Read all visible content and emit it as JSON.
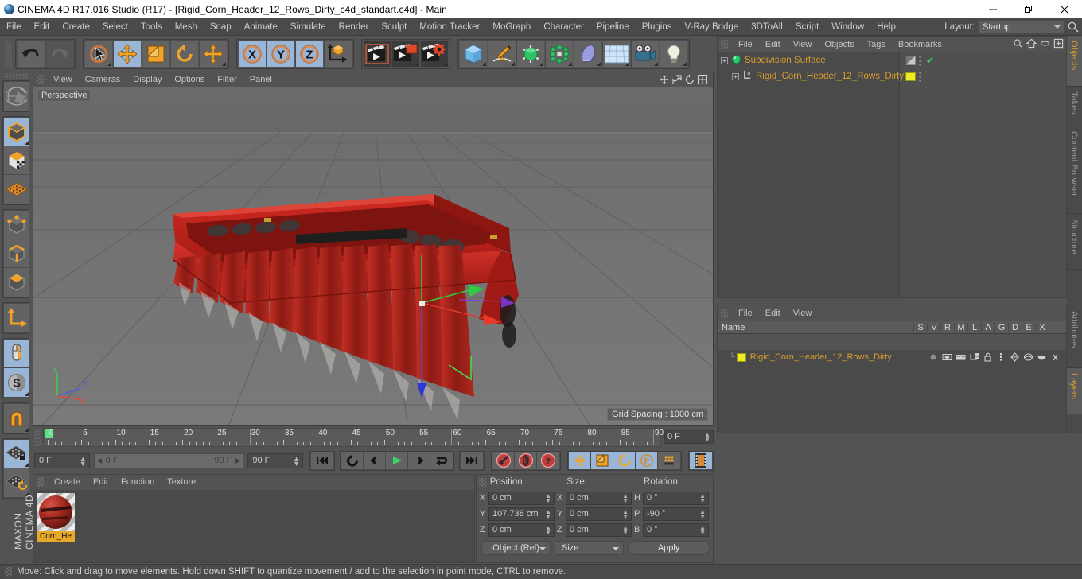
{
  "window": {
    "title": "CINEMA 4D R17.016 Studio (R17) - [Rigid_Corn_Header_12_Rows_Dirty_c4d_standart.c4d] - Main",
    "app_icon": "cinema4d-orb-icon",
    "minimize": "minimize-icon",
    "maximize": "restore-icon",
    "close": "close-icon"
  },
  "menubar": {
    "items": [
      "File",
      "Edit",
      "Create",
      "Select",
      "Tools",
      "Mesh",
      "Snap",
      "Animate",
      "Simulate",
      "Render",
      "Sculpt",
      "Motion Tracker",
      "MoGraph",
      "Character",
      "Pipeline",
      "Plugins",
      "V-Ray Bridge",
      "3DToAll",
      "Script",
      "Window",
      "Help"
    ],
    "layout_label": "Layout:",
    "layout_value": "Startup",
    "search_icon": "search-icon"
  },
  "toolbar": {
    "groups": [
      {
        "name": "history",
        "buttons": [
          {
            "icon": "undo-icon",
            "selected": false,
            "disabled": false
          },
          {
            "icon": "redo-icon",
            "selected": false,
            "disabled": true
          }
        ]
      },
      {
        "name": "selection-transform",
        "buttons": [
          {
            "icon": "live-selection-icon",
            "selected": false,
            "menu": true
          },
          {
            "icon": "move-icon",
            "selected": true
          },
          {
            "icon": "scale-icon",
            "selected": false
          },
          {
            "icon": "rotate-icon",
            "selected": false
          },
          {
            "icon": "move-dynamic-icon",
            "selected": false,
            "menu": true
          }
        ]
      },
      {
        "name": "axis-locks",
        "buttons": [
          {
            "icon": "x-axis-icon",
            "selected": true
          },
          {
            "icon": "y-axis-icon",
            "selected": true
          },
          {
            "icon": "z-axis-icon",
            "selected": true
          },
          {
            "icon": "world-object-axis-icon",
            "selected": false
          }
        ]
      },
      {
        "name": "render",
        "buttons": [
          {
            "icon": "render-view-icon",
            "selected": false
          },
          {
            "icon": "render-to-picture-viewer-icon",
            "selected": false,
            "menu": true
          },
          {
            "icon": "render-settings-icon",
            "selected": false,
            "menu": true
          }
        ]
      },
      {
        "name": "create",
        "buttons": [
          {
            "icon": "cube-primitive-icon",
            "selected": false,
            "menu": true
          },
          {
            "icon": "spline-pen-icon",
            "selected": false,
            "menu": true
          },
          {
            "icon": "nurbs-icon",
            "selected": false,
            "menu": true
          },
          {
            "icon": "array-modeling-icon",
            "selected": false,
            "menu": true
          },
          {
            "icon": "bend-deformer-icon",
            "selected": false,
            "menu": true
          },
          {
            "icon": "floor-environment-icon",
            "selected": false,
            "menu": true
          },
          {
            "icon": "camera-icon",
            "selected": false,
            "menu": true
          },
          {
            "icon": "light-icon",
            "selected": false,
            "menu": true
          }
        ]
      }
    ]
  },
  "left_toolbar": {
    "groups": [
      {
        "buttons": [
          {
            "icon": "make-editable-icon",
            "selected": false
          }
        ]
      },
      {
        "buttons": [
          {
            "icon": "model-mode-icon",
            "selected": true,
            "menu": true
          },
          {
            "icon": "texture-mode-icon",
            "selected": false
          },
          {
            "icon": "workplane-mode-icon",
            "selected": false
          }
        ]
      },
      {
        "buttons": [
          {
            "icon": "points-mode-icon",
            "selected": false
          },
          {
            "icon": "edges-mode-icon",
            "selected": false
          },
          {
            "icon": "polygons-mode-icon",
            "selected": false
          }
        ]
      },
      {
        "buttons": [
          {
            "icon": "object-axis-icon",
            "selected": false
          }
        ]
      },
      {
        "buttons": [
          {
            "icon": "viewport-solo-icon",
            "selected": true
          },
          {
            "icon": "snap-settings-icon",
            "selected": true,
            "menu": true
          }
        ]
      },
      {
        "buttons": [
          {
            "icon": "magnet-icon",
            "selected": false,
            "menu": true
          }
        ]
      },
      {
        "buttons": [
          {
            "icon": "workplane-lock-icon",
            "selected": true,
            "menu": true
          },
          {
            "icon": "workplane-rotate-icon",
            "selected": false,
            "menu": true
          }
        ]
      }
    ],
    "brand_line1": "MAXON",
    "brand_line2": "CINEMA 4D"
  },
  "viewport": {
    "menu": [
      "View",
      "Cameras",
      "Display",
      "Options",
      "Filter",
      "Panel"
    ],
    "label": "Perspective",
    "grid_spacing": "Grid Spacing : 1000 cm",
    "axis_gizmo": {
      "x": "X",
      "y": "Y",
      "z": "Z"
    },
    "nav_icons": [
      "move-camera-icon",
      "scale-camera-icon",
      "rotate-camera-icon",
      "maximize-viewport-icon"
    ],
    "model_name": "rigid-corn-header-12-rows-dirty-model",
    "model_color": "#c0201c"
  },
  "timeline": {
    "ticks": [
      0,
      5,
      10,
      15,
      20,
      25,
      30,
      35,
      40,
      45,
      50,
      55,
      60,
      65,
      70,
      75,
      80,
      85,
      90
    ],
    "current_frame_field": "0 F",
    "playhead_frame": 0
  },
  "playbar": {
    "current_frame": "0 F",
    "range_start": "0 F",
    "range_end": "90 F",
    "max_frame": "90 F",
    "buttons": [
      {
        "icon": "go-to-start-icon"
      },
      {
        "icon": "play-backwards-loop-icon"
      },
      {
        "icon": "step-back-icon"
      },
      {
        "icon": "play-forward-icon",
        "accent": "#3ad46a"
      },
      {
        "icon": "step-forward-icon"
      },
      {
        "icon": "loop-icon"
      },
      {
        "icon": "go-to-end-icon"
      }
    ],
    "key_buttons": [
      {
        "icon": "record-key-icon"
      },
      {
        "icon": "autokeying-icon"
      },
      {
        "icon": "keyframe-selection-icon"
      }
    ],
    "anim_mode_buttons": [
      {
        "icon": "position-key-icon",
        "selected": true
      },
      {
        "icon": "scale-key-icon",
        "selected": true
      },
      {
        "icon": "rotation-key-icon",
        "selected": true
      },
      {
        "icon": "pla-key-icon",
        "selected": true
      },
      {
        "icon": "point-level-anim-icon",
        "selected": false
      }
    ],
    "extra_button": {
      "icon": "timeline-filmstrip-icon"
    }
  },
  "material_manager": {
    "menu": [
      "Create",
      "Edit",
      "Function",
      "Texture"
    ],
    "materials": [
      {
        "name": "Corn_He",
        "full_name": "Corn_Header"
      }
    ]
  },
  "coordinates": {
    "headers": [
      "Position",
      "Size",
      "Rotation"
    ],
    "position": {
      "labels": [
        "X",
        "Y",
        "Z"
      ],
      "values": [
        "0 cm",
        "107.738 cm",
        "0 cm"
      ]
    },
    "size": {
      "labels": [
        "X",
        "Y",
        "Z"
      ],
      "values": [
        "0 cm",
        "0 cm",
        "0 cm"
      ]
    },
    "rotation": {
      "labels": [
        "H",
        "P",
        "B"
      ],
      "values": [
        "0 °",
        "-90 °",
        "0 °"
      ]
    },
    "mode_dropdown": "Object (Rel)",
    "size_dropdown": "Size",
    "apply_label": "Apply"
  },
  "object_manager": {
    "menu": [
      "File",
      "Edit",
      "View",
      "Objects",
      "Tags",
      "Bookmarks"
    ],
    "tools": [
      "search-icon",
      "home-icon",
      "ellipse-icon",
      "plus-box-icon"
    ],
    "rows": [
      {
        "label": "Subdivision Surface",
        "icon": "subdivision-surface-icon",
        "indent": 0,
        "tag": "display-tag",
        "check": true
      },
      {
        "label": "Rigid_Corn_Header_12_Rows_Dirty",
        "icon": "null-object-icon",
        "indent": 1,
        "tag": "material-tag",
        "tag_color": "#ecec23"
      }
    ]
  },
  "layer_manager": {
    "menu": [
      "File",
      "Edit",
      "View"
    ],
    "columns": [
      "Name",
      "S",
      "V",
      "R",
      "M",
      "L",
      "A",
      "G",
      "D",
      "E",
      "X"
    ],
    "rows": [
      {
        "name": "Rigid_Corn_Header_12_Rows_Dirty",
        "swatch": "#ecec23"
      }
    ]
  },
  "vertical_tabs_right": [
    {
      "label": "Objects",
      "active": true
    },
    {
      "label": "Takes",
      "active": false
    },
    {
      "label": "Content Browser",
      "active": false
    },
    {
      "label": "Structure",
      "active": false
    }
  ],
  "vertical_tabs_right_lower": [
    {
      "label": "Attributes",
      "active": false
    },
    {
      "label": "Layers",
      "active": true
    }
  ],
  "statusbar": {
    "text": "Move: Click and drag to move elements. Hold down SHIFT to quantize movement / add to the selection in point mode, CTRL to remove."
  }
}
